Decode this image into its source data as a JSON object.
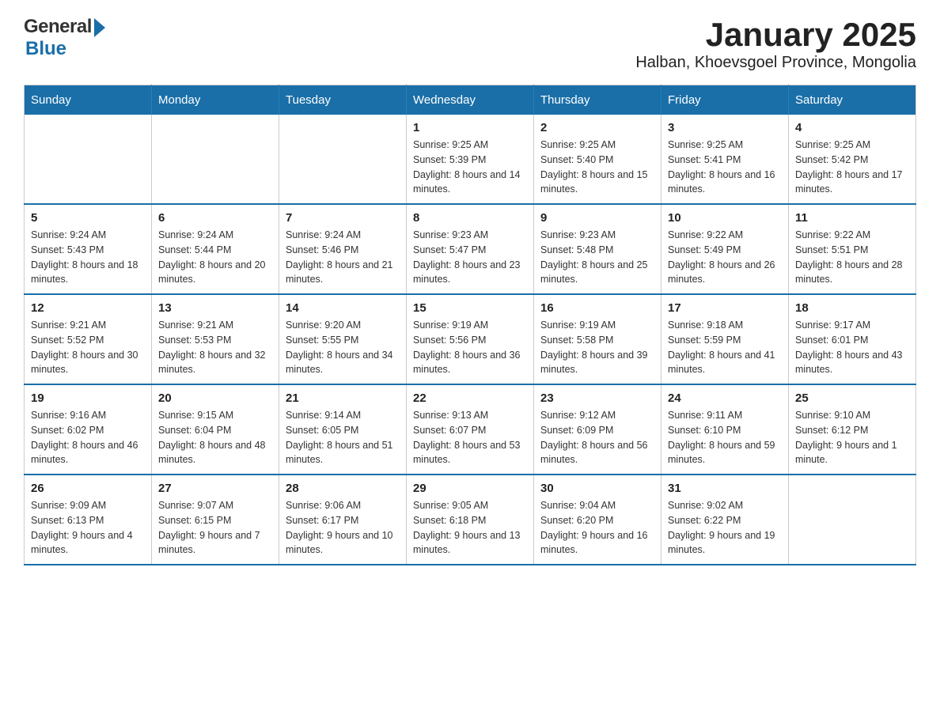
{
  "header": {
    "logo_general": "General",
    "logo_blue": "Blue",
    "title": "January 2025",
    "subtitle": "Halban, Khoevsgoel Province, Mongolia"
  },
  "calendar": {
    "days_of_week": [
      "Sunday",
      "Monday",
      "Tuesday",
      "Wednesday",
      "Thursday",
      "Friday",
      "Saturday"
    ],
    "weeks": [
      [
        {
          "day": "",
          "sunrise": "",
          "sunset": "",
          "daylight": ""
        },
        {
          "day": "",
          "sunrise": "",
          "sunset": "",
          "daylight": ""
        },
        {
          "day": "",
          "sunrise": "",
          "sunset": "",
          "daylight": ""
        },
        {
          "day": "1",
          "sunrise": "Sunrise: 9:25 AM",
          "sunset": "Sunset: 5:39 PM",
          "daylight": "Daylight: 8 hours and 14 minutes."
        },
        {
          "day": "2",
          "sunrise": "Sunrise: 9:25 AM",
          "sunset": "Sunset: 5:40 PM",
          "daylight": "Daylight: 8 hours and 15 minutes."
        },
        {
          "day": "3",
          "sunrise": "Sunrise: 9:25 AM",
          "sunset": "Sunset: 5:41 PM",
          "daylight": "Daylight: 8 hours and 16 minutes."
        },
        {
          "day": "4",
          "sunrise": "Sunrise: 9:25 AM",
          "sunset": "Sunset: 5:42 PM",
          "daylight": "Daylight: 8 hours and 17 minutes."
        }
      ],
      [
        {
          "day": "5",
          "sunrise": "Sunrise: 9:24 AM",
          "sunset": "Sunset: 5:43 PM",
          "daylight": "Daylight: 8 hours and 18 minutes."
        },
        {
          "day": "6",
          "sunrise": "Sunrise: 9:24 AM",
          "sunset": "Sunset: 5:44 PM",
          "daylight": "Daylight: 8 hours and 20 minutes."
        },
        {
          "day": "7",
          "sunrise": "Sunrise: 9:24 AM",
          "sunset": "Sunset: 5:46 PM",
          "daylight": "Daylight: 8 hours and 21 minutes."
        },
        {
          "day": "8",
          "sunrise": "Sunrise: 9:23 AM",
          "sunset": "Sunset: 5:47 PM",
          "daylight": "Daylight: 8 hours and 23 minutes."
        },
        {
          "day": "9",
          "sunrise": "Sunrise: 9:23 AM",
          "sunset": "Sunset: 5:48 PM",
          "daylight": "Daylight: 8 hours and 25 minutes."
        },
        {
          "day": "10",
          "sunrise": "Sunrise: 9:22 AM",
          "sunset": "Sunset: 5:49 PM",
          "daylight": "Daylight: 8 hours and 26 minutes."
        },
        {
          "day": "11",
          "sunrise": "Sunrise: 9:22 AM",
          "sunset": "Sunset: 5:51 PM",
          "daylight": "Daylight: 8 hours and 28 minutes."
        }
      ],
      [
        {
          "day": "12",
          "sunrise": "Sunrise: 9:21 AM",
          "sunset": "Sunset: 5:52 PM",
          "daylight": "Daylight: 8 hours and 30 minutes."
        },
        {
          "day": "13",
          "sunrise": "Sunrise: 9:21 AM",
          "sunset": "Sunset: 5:53 PM",
          "daylight": "Daylight: 8 hours and 32 minutes."
        },
        {
          "day": "14",
          "sunrise": "Sunrise: 9:20 AM",
          "sunset": "Sunset: 5:55 PM",
          "daylight": "Daylight: 8 hours and 34 minutes."
        },
        {
          "day": "15",
          "sunrise": "Sunrise: 9:19 AM",
          "sunset": "Sunset: 5:56 PM",
          "daylight": "Daylight: 8 hours and 36 minutes."
        },
        {
          "day": "16",
          "sunrise": "Sunrise: 9:19 AM",
          "sunset": "Sunset: 5:58 PM",
          "daylight": "Daylight: 8 hours and 39 minutes."
        },
        {
          "day": "17",
          "sunrise": "Sunrise: 9:18 AM",
          "sunset": "Sunset: 5:59 PM",
          "daylight": "Daylight: 8 hours and 41 minutes."
        },
        {
          "day": "18",
          "sunrise": "Sunrise: 9:17 AM",
          "sunset": "Sunset: 6:01 PM",
          "daylight": "Daylight: 8 hours and 43 minutes."
        }
      ],
      [
        {
          "day": "19",
          "sunrise": "Sunrise: 9:16 AM",
          "sunset": "Sunset: 6:02 PM",
          "daylight": "Daylight: 8 hours and 46 minutes."
        },
        {
          "day": "20",
          "sunrise": "Sunrise: 9:15 AM",
          "sunset": "Sunset: 6:04 PM",
          "daylight": "Daylight: 8 hours and 48 minutes."
        },
        {
          "day": "21",
          "sunrise": "Sunrise: 9:14 AM",
          "sunset": "Sunset: 6:05 PM",
          "daylight": "Daylight: 8 hours and 51 minutes."
        },
        {
          "day": "22",
          "sunrise": "Sunrise: 9:13 AM",
          "sunset": "Sunset: 6:07 PM",
          "daylight": "Daylight: 8 hours and 53 minutes."
        },
        {
          "day": "23",
          "sunrise": "Sunrise: 9:12 AM",
          "sunset": "Sunset: 6:09 PM",
          "daylight": "Daylight: 8 hours and 56 minutes."
        },
        {
          "day": "24",
          "sunrise": "Sunrise: 9:11 AM",
          "sunset": "Sunset: 6:10 PM",
          "daylight": "Daylight: 8 hours and 59 minutes."
        },
        {
          "day": "25",
          "sunrise": "Sunrise: 9:10 AM",
          "sunset": "Sunset: 6:12 PM",
          "daylight": "Daylight: 9 hours and 1 minute."
        }
      ],
      [
        {
          "day": "26",
          "sunrise": "Sunrise: 9:09 AM",
          "sunset": "Sunset: 6:13 PM",
          "daylight": "Daylight: 9 hours and 4 minutes."
        },
        {
          "day": "27",
          "sunrise": "Sunrise: 9:07 AM",
          "sunset": "Sunset: 6:15 PM",
          "daylight": "Daylight: 9 hours and 7 minutes."
        },
        {
          "day": "28",
          "sunrise": "Sunrise: 9:06 AM",
          "sunset": "Sunset: 6:17 PM",
          "daylight": "Daylight: 9 hours and 10 minutes."
        },
        {
          "day": "29",
          "sunrise": "Sunrise: 9:05 AM",
          "sunset": "Sunset: 6:18 PM",
          "daylight": "Daylight: 9 hours and 13 minutes."
        },
        {
          "day": "30",
          "sunrise": "Sunrise: 9:04 AM",
          "sunset": "Sunset: 6:20 PM",
          "daylight": "Daylight: 9 hours and 16 minutes."
        },
        {
          "day": "31",
          "sunrise": "Sunrise: 9:02 AM",
          "sunset": "Sunset: 6:22 PM",
          "daylight": "Daylight: 9 hours and 19 minutes."
        },
        {
          "day": "",
          "sunrise": "",
          "sunset": "",
          "daylight": ""
        }
      ]
    ]
  }
}
